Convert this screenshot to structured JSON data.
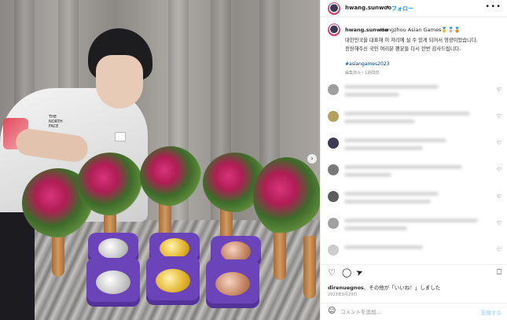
{
  "header": {
    "username": "hwang.sunwoo",
    "separator": "•",
    "follow_label": "フォロー",
    "more_label": "•••"
  },
  "caption": {
    "username": "hwang.sunwoo",
    "first_line": "Hangzhou Asian Games🥇🥈🥉",
    "line2": "대한민국을 대표해 이 자리에 설 수 있게 되어서 영광이었습니다.",
    "line3": "응원해주신 국민 여러분 팬분들 다시 한번 감사드립니다.",
    "hashtag": "#asiangames2023",
    "edited": "編集済み・1週間前"
  },
  "post_actions": {
    "like_icon": "heart-icon",
    "comment_icon": "comment-icon",
    "share_icon": "share-icon",
    "save_icon": "bookmark-icon"
  },
  "likes": {
    "user": "direnuegnos",
    "text": "その他が「いいね！」しました",
    "suffix": "、"
  },
  "date": "2023年9月29日",
  "comment_box": {
    "placeholder": "コメントを追加...",
    "post_label": "投稿する"
  },
  "photo": {
    "next_label": "›",
    "jacket_logo": "THE NORTH FACE"
  },
  "colors": {
    "follow": "#0095f6",
    "medal_box": "#6a44b8",
    "gold": "#e5b834",
    "silver": "#c9c9c9",
    "bronze": "#c98a6a"
  }
}
